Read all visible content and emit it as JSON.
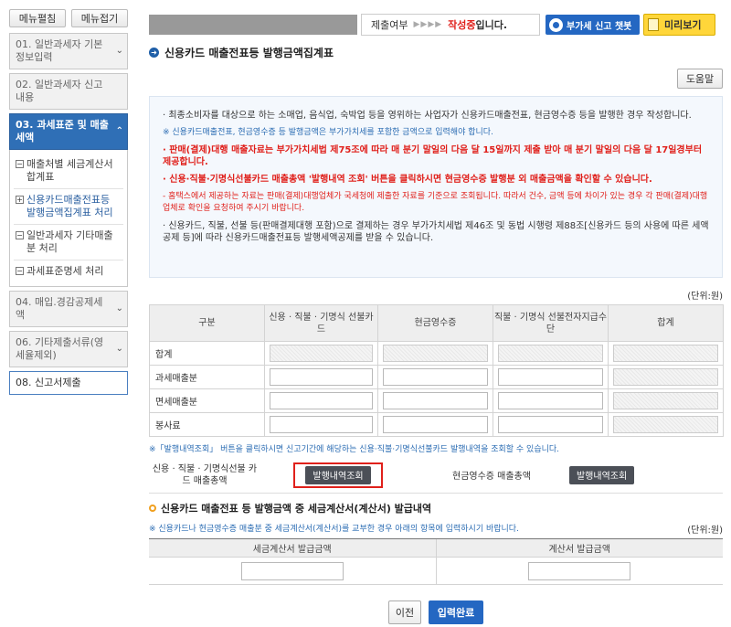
{
  "sidebar": {
    "menu_edit": "메뉴펼침",
    "menu_collapse": "메뉴접기",
    "items": [
      {
        "label": "01. 일반과세자 기본정보입력"
      },
      {
        "label": "02. 일반과세자 신고내용"
      },
      {
        "label": "03. 과세표준 및 매출세액"
      },
      {
        "label": "04. 매입.경감공제세액"
      },
      {
        "label": "06. 기타제출서류(영세율제외)"
      },
      {
        "label": "08. 신고서제출"
      }
    ],
    "sub_items": [
      {
        "label": "매출처별 세금계산서합계표"
      },
      {
        "label": "신용카드매출전표등 발행금액집계표 처리"
      },
      {
        "label": "일반과세자 기타매출분 처리"
      },
      {
        "label": "과세표준명세 처리"
      }
    ]
  },
  "topbar": {
    "status_label": "제출여부",
    "status_arrows": "▶▶▶▶",
    "status_value": "작성중",
    "status_suffix": "입니다.",
    "chatbot_label": "부가세 신고 챗봇",
    "preview_label": "미리보기"
  },
  "main": {
    "title": "신용카드 매출전표등 발행금액집계표",
    "help_label": "도움말",
    "notice": {
      "p1": "· 최종소비자를 대상으로 하는 소매업, 음식업, 숙박업 등을 영위하는 사업자가 신용카드매출전표, 현금영수증 등을 발행한 경우 작성합니다.",
      "p2": "※ 신용카드매출전표, 현금영수증 등 발행금액은 부가가치세를 포함한 금액으로 입력해야 합니다.",
      "p3": "· 판매(결제)대행 매출자료는 부가가치세법 제75조에 따라 매 분기 말일의 다음 달 15일까지 제출 받아 매 분기 말일의 다음 달 17일경부터 제공합니다.",
      "p4": "· 신용·직불·기명식선불카드 매출총액 '발행내역 조회' 버튼을 클릭하시면 현금영수증 발행분 외 매출금액을 확인할 수 있습니다.",
      "p5": "- 홈택스에서 제공하는 자료는 판매(결제)대행업체가 국세청에 제출한 자료를 기준으로 조회됩니다. 따라서 건수, 금액 등에 차이가 있는 경우 각 판매(결제)대행업체로 확인을 요청하여 주시기 바랍니다.",
      "p6": "· 신용카드, 직불, 선불 등(판매결제대행 포함)으로 결제하는 경우 부가가치세법 제46조 및 동법 시행령 제88조[신용카드 등의 사용에 따른 세액공제 등]에 따라 신용카드매출전표등 발행세액공제를 받을 수 있습니다."
    },
    "unit": "(단위:원)",
    "table": {
      "headers": [
        "구분",
        "신용 · 직불 · 기명식 선불카드",
        "현금영수증",
        "직불 · 기명식 선불전자지급수단",
        "합계"
      ],
      "rows": [
        "합계",
        "과세매출분",
        "면세매출분",
        "봉사료"
      ]
    },
    "hint": "※「발행내역조회」 버튼을 클릭하시면 신고기간에 해당하는 신용·직불·기명식선불카드 발행내역을 조회할 수 있습니다.",
    "query_label": "신용 · 직불 · 기명식선불 카드 매출총액",
    "query_btn": "발행내역조회",
    "cash_label": "현금영수증 매출총액",
    "cash_btn": "발행내역조회",
    "sub_title": "신용카드 매출전표 등 발행금액 중 세금계산서(계산서) 발급내역",
    "sub_hint": "※ 신용카드나 현금영수증 매출분 중 세금계산서(계산서)를 교부한 경우 아래의 항목에 입력하시기 바랍니다.",
    "sub_unit": "(단위:원)",
    "table2": {
      "headers": [
        "세금계산서 발급금액",
        "계산서 발급금액"
      ]
    },
    "prev_label": "이전",
    "done_label": "입력완료"
  }
}
